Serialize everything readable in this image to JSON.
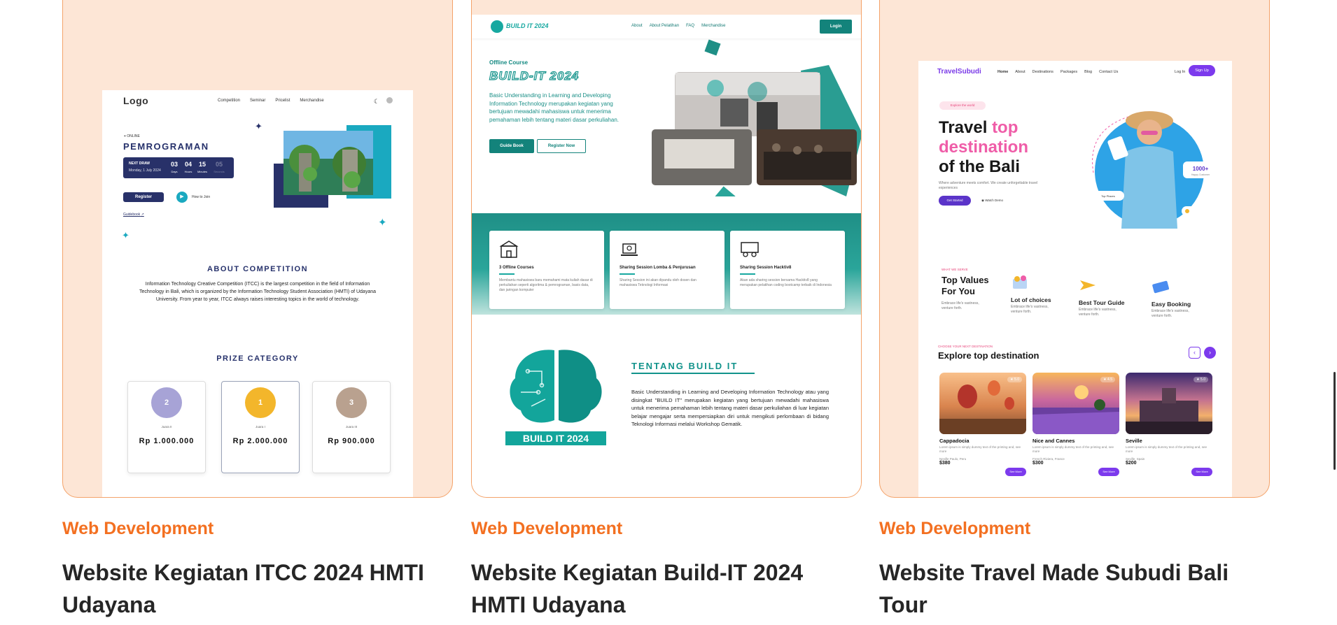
{
  "projects": [
    {
      "category": "Web Development",
      "title": "Website Kegiatan ITCC 2024 HMTI Udayana",
      "preview": {
        "logo": "Logo",
        "nav": [
          "Competition",
          "Seminar",
          "Pricelist",
          "Merchandise"
        ],
        "status": "ONLINE",
        "heading": "PEMROGRAMAN",
        "next_draw": "NEXT DRAW",
        "next_draw_date": "Monday, 1 July 2024",
        "countdown": [
          {
            "value": "03",
            "label": "Days"
          },
          {
            "value": "04",
            "label": "Hours"
          },
          {
            "value": "15",
            "label": "Minutes"
          },
          {
            "value": "05",
            "label": "Seconds"
          }
        ],
        "register": "Register",
        "how_to_join": "How to Join",
        "guidebook": "Guidebook",
        "about_heading": "ABOUT COMPETITION",
        "about_text": "Information Technology Creative Competition (ITCC) is the largest competition in the field of Information Technology in Bali, which is organized by the Information Technology Student Association (HMTI) of Udayana University. From year to year, ITCC always raises interesting topics in the world of technology.",
        "prize_heading": "PRIZE CATEGORY",
        "prizes": [
          {
            "rank": "2",
            "label": "Juara II",
            "amount": "Rp 1.000.000",
            "color": "#a7a3d6"
          },
          {
            "rank": "1",
            "label": "Juara I",
            "amount": "Rp 2.000.000",
            "color": "#f3b62b"
          },
          {
            "rank": "3",
            "label": "Juara III",
            "amount": "Rp 900.000",
            "color": "#b9a18f"
          }
        ]
      }
    },
    {
      "category": "Web Development",
      "title": "Website Kegiatan Build-IT 2024 HMTI Udayana",
      "preview": {
        "logo": "BUILD IT 2024",
        "nav": [
          "About",
          "About Pelatihan",
          "FAQ",
          "Merchandise"
        ],
        "login": "Login",
        "kicker": "Offline Course",
        "heading": "BUILD-IT 2024",
        "desc": "Basic Understanding in Learning and Developing Information Technology merupakan kegiatan yang bertujuan mewadahi mahasiswa untuk menerima pemahaman lebih tentang materi dasar perkuliahan.",
        "btn_guide": "Guide Book",
        "btn_register": "Register Now",
        "features": [
          {
            "title": "3 Offline Courses",
            "desc": "Membantu mahasiswa baru memahami mata kuliah dasar di perkuliahan seperti algoritma & pemrograman, basis data, dan jaringan komputer"
          },
          {
            "title": "Sharing Session Lomba & Penjurusan",
            "desc": "Sharing Session ini akan dipandu oleh dosen dan mahasiswa Teknologi Informasi"
          },
          {
            "title": "Sharing Session Hacktiv8",
            "desc": "Akan ada sharing session bersama Hacktiv8 yang merupakan pelatihan coding bootcamp terbaik di Indonesia"
          }
        ],
        "about_heading": "TENTANG BUILD IT",
        "about_text": "Basic Understanding in Learning and Developing Information Technology atau yang disingkat \"BUILD IT\" merupakan kegiatan yang bertujuan mewadahi mahasiswa untuk menerima pemahaman lebih tentang materi dasar perkuliahan di luar kegiatan belajar mengajar serta mempersiapkan diri untuk mengikuti perlombaan di bidang Teknologi Informasi melalui Workshop Gematik.",
        "big_logo": "BUILD IT 2024"
      }
    },
    {
      "category": "Web Development",
      "title": "Website Travel Made Subudi Bali Tour",
      "preview": {
        "logo": "TravelSubudi",
        "nav": [
          "Home",
          "About",
          "Destinations",
          "Packages",
          "Blog",
          "Contact Us"
        ],
        "login": "Log In",
        "signup": "Sign Up",
        "explore_badge": "Explore the world",
        "hero_line1": "Travel ",
        "hero_pink1": "top",
        "hero_pink2": "destination",
        "hero_line3": "of the Bali",
        "hero_sub": "Where adventure meets comfort. We create unforgettable travel experiences",
        "get_started": "Get Started",
        "watch_demo": "Watch Demo",
        "badge_count": "1000+",
        "badge_count_sub": "Happy Customer",
        "badge_top": "Top Places",
        "what_we_serve": "WHAT WE SERVE",
        "values_title": "Top Values For You",
        "values_sub": "Embrace life's vastness, venture forth.",
        "services": [
          {
            "title": "Lot of choices",
            "desc": "Embrace life's vastness, venture forth."
          },
          {
            "title": "Best Tour Guide",
            "desc": "Embrace life's vastness, venture forth."
          },
          {
            "title": "Easy Booking",
            "desc": "Embrace life's vastness, venture forth."
          }
        ],
        "choose_label": "CHOOSE YOUR NEXT DESTINATION",
        "explore_heading": "Explore top destination",
        "destinations": [
          {
            "name": "Cappadocia",
            "rating": "5.0",
            "location": "Neville Paulo, Peru",
            "price": "$380",
            "see": "See More"
          },
          {
            "name": "Nice and Cannes",
            "rating": "4.5",
            "location": "French Riviera, France",
            "price": "$300",
            "see": "See More"
          },
          {
            "name": "Seville",
            "rating": "5.0",
            "location": "Seville, Spain",
            "price": "$200",
            "see": "See More"
          }
        ],
        "dest_desc": "Lorem ipsum is simply dummy text of the printing and, see more"
      }
    }
  ]
}
